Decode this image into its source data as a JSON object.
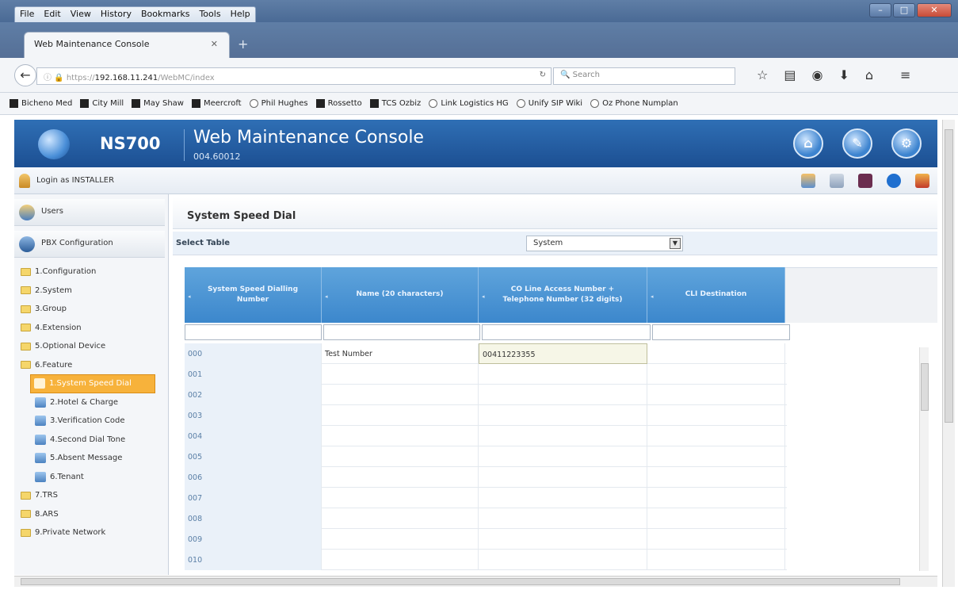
{
  "browser": {
    "menu": [
      "File",
      "Edit",
      "View",
      "History",
      "Bookmarks",
      "Tools",
      "Help"
    ],
    "tab_title": "Web Maintenance Console",
    "url_prefix": "https://",
    "url_host": "192.168.11.241",
    "url_path": "/WebMC/index",
    "search_placeholder": "Search",
    "bookmarks": [
      {
        "label": "Bicheno Med",
        "icon": "square"
      },
      {
        "label": "City Mill",
        "icon": "square"
      },
      {
        "label": "May Shaw",
        "icon": "square"
      },
      {
        "label": "Meercroft",
        "icon": "square"
      },
      {
        "label": "Phil Hughes",
        "icon": "globe"
      },
      {
        "label": "Rossetto",
        "icon": "square"
      },
      {
        "label": "TCS Ozbiz",
        "icon": "square"
      },
      {
        "label": "Link Logistics HG",
        "icon": "globe"
      },
      {
        "label": "Unify SIP Wiki",
        "icon": "globe"
      },
      {
        "label": "Oz Phone Numplan",
        "icon": "globe"
      }
    ]
  },
  "app": {
    "name": "NS700",
    "title": "Web Maintenance Console",
    "version": "004.60012",
    "login_text": "Login as INSTALLER"
  },
  "sidebar": {
    "users_label": "Users",
    "pbx_label": "PBX Configuration",
    "items": [
      {
        "label": "1.Configuration",
        "level": 0
      },
      {
        "label": "2.System",
        "level": 0
      },
      {
        "label": "3.Group",
        "level": 0
      },
      {
        "label": "4.Extension",
        "level": 0
      },
      {
        "label": "5.Optional Device",
        "level": 0
      },
      {
        "label": "6.Feature",
        "level": 0
      },
      {
        "label": "1.System Speed Dial",
        "level": 1,
        "active": true
      },
      {
        "label": "2.Hotel & Charge",
        "level": 1
      },
      {
        "label": "3.Verification Code",
        "level": 1
      },
      {
        "label": "4.Second Dial Tone",
        "level": 1
      },
      {
        "label": "5.Absent Message",
        "level": 1
      },
      {
        "label": "6.Tenant",
        "level": 1
      },
      {
        "label": "7.TRS",
        "level": 0
      },
      {
        "label": "8.ARS",
        "level": 0
      },
      {
        "label": "9.Private Network",
        "level": 0
      }
    ]
  },
  "main": {
    "title": "System Speed Dial",
    "select_label": "Select Table",
    "select_value": "System",
    "columns": [
      "System Speed Dialling Number",
      "Name (20 characters)",
      "CO Line Access Number + Telephone Number (32 digits)",
      "CLI Destination"
    ],
    "rows": [
      {
        "num": "000",
        "name": "Test Number",
        "tel": "00411223355",
        "cli": ""
      },
      {
        "num": "001",
        "name": "",
        "tel": "",
        "cli": ""
      },
      {
        "num": "002",
        "name": "",
        "tel": "",
        "cli": ""
      },
      {
        "num": "003",
        "name": "",
        "tel": "",
        "cli": ""
      },
      {
        "num": "004",
        "name": "",
        "tel": "",
        "cli": ""
      },
      {
        "num": "005",
        "name": "",
        "tel": "",
        "cli": ""
      },
      {
        "num": "006",
        "name": "",
        "tel": "",
        "cli": ""
      },
      {
        "num": "007",
        "name": "",
        "tel": "",
        "cli": ""
      },
      {
        "num": "008",
        "name": "",
        "tel": "",
        "cli": ""
      },
      {
        "num": "009",
        "name": "",
        "tel": "",
        "cli": ""
      },
      {
        "num": "010",
        "name": "",
        "tel": "",
        "cli": ""
      }
    ]
  }
}
